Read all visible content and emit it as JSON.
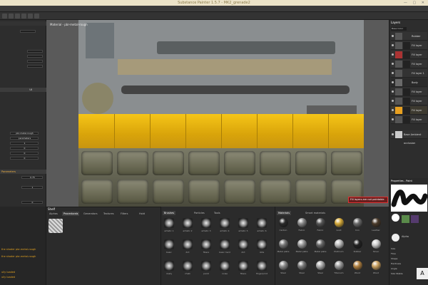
{
  "window": {
    "title": "Substance Painter 1.5.7 - MK2_grenade2",
    "controls": "— ▢ ✕"
  },
  "viewport": {
    "label": "Material - pbr-metal-rough",
    "warning": "Fill layers are not paintable"
  },
  "left_panel": {
    "values": [
      "pbr-metal-rough",
      "parameters",
      "1",
      "0",
      "0",
      "0"
    ],
    "section": "Parameters",
    "small_values": [
      "0.75",
      "1",
      "0"
    ],
    "ui_label": "UI"
  },
  "left_bottom": {
    "lines": [
      "the shader pbr-metal-rough",
      "the shader pbr-metal-rough",
      "ully loaded",
      "ully loaded"
    ]
  },
  "layers": {
    "title": "Layers",
    "blend": "Base Color",
    "items": [
      "Rubber",
      "Fill layer",
      "Fill layer",
      "Fill layer",
      "Fill layer 1",
      "Body",
      "Fill layer",
      "Fill layer",
      "Fill layer",
      "Fill layer",
      "Base Ambient occlusion"
    ]
  },
  "properties": {
    "title": "Properties - Paint",
    "alpha": "Alpha",
    "labels": [
      "Size",
      "Flow",
      "Shape",
      "Hardness",
      "Angle",
      "Size Stable"
    ]
  },
  "shelf": {
    "title": "Shelf",
    "tabs": [
      "Alphas",
      "Procedurals",
      "Generators",
      "Textures",
      "Filters",
      "Hold"
    ]
  },
  "brushes": {
    "tabs": [
      "Brushes",
      "Particles",
      "Tools"
    ],
    "items": [
      "artistic 1",
      "artistic 2",
      "artistic 3",
      "artistic 4",
      "artistic 5",
      "artistic 6",
      "basic",
      "dirt",
      "fibers",
      "basic hard",
      "dirt",
      "dots",
      "dusty",
      "chalk",
      "paint",
      "noise",
      "fibers",
      "fingerprint"
    ]
  },
  "materials": {
    "tabs": [
      "Materials",
      "Smart materials"
    ],
    "items": [
      "Carbon",
      "Fabric",
      "Fabric",
      "Gold",
      "Iron",
      "Leather",
      "Metal plate",
      "Metal plate",
      "Metal plate",
      "Platinum",
      "Rubber",
      "Silver",
      "Steel",
      "Steel",
      "Steel",
      "Titanium",
      "Wood",
      "Wood"
    ]
  },
  "colors": {
    "accent": "#f5c518",
    "warning": "#d33333"
  }
}
